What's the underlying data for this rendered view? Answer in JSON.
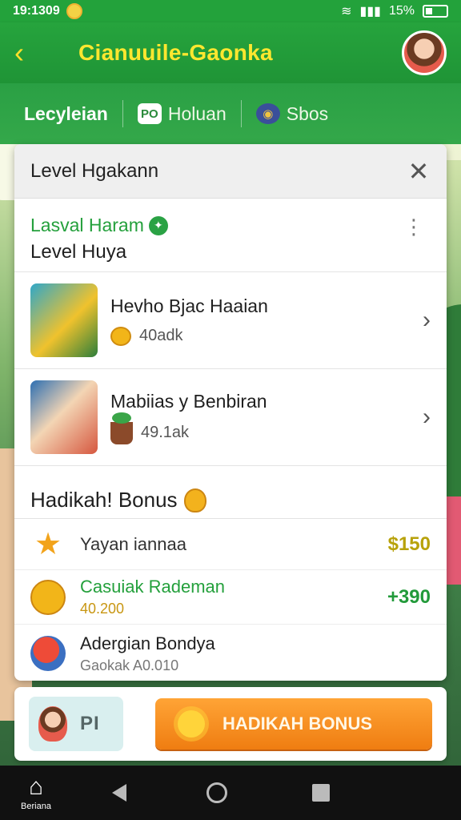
{
  "status_bar": {
    "time": "19:1309",
    "battery": "15%"
  },
  "header": {
    "title": "Cianuuile-Gaonka",
    "back_icon": "chevron-left-icon",
    "avatar_icon": "avatar-icon"
  },
  "tabs": [
    {
      "label": "Lecyleian",
      "icon": ""
    },
    {
      "label": "Holuan",
      "icon": "PO"
    },
    {
      "label": "Sbos",
      "icon": ""
    }
  ],
  "modal": {
    "title": "Level Hgakann",
    "close_icon": "close-icon",
    "level": {
      "subtitle": "Lasval Haram",
      "title": "Level Huya"
    },
    "items": [
      {
        "name": "Hevho Bjac Haaian",
        "value": "40adk",
        "icon": "coin-icon"
      },
      {
        "name": "Mabiias y Benbiran",
        "value": "49.1ak",
        "icon": "plant-icon"
      }
    ],
    "bonus": {
      "title": "Hadikah! Bonus",
      "rows": [
        {
          "name": "Yayan iannaa",
          "sub": "",
          "amount": "$150",
          "icon": "star-icon"
        },
        {
          "name": "Casuiak Rademan",
          "sub": "40.200",
          "amount": "+390",
          "icon": "moneybag-icon"
        },
        {
          "name": "Adergian Bondya",
          "sub": "Gaokak A0.010",
          "amount": "",
          "icon": "apple-icon"
        }
      ]
    }
  },
  "bottom": {
    "promo_text": "PI",
    "cta_label": "HADIKAH BONUS"
  },
  "navbar": {
    "home_label": "Beriana"
  },
  "colors": {
    "primary_green": "#23a23b",
    "title_yellow": "#ffe72f",
    "cta_orange": "#ef7d11"
  }
}
